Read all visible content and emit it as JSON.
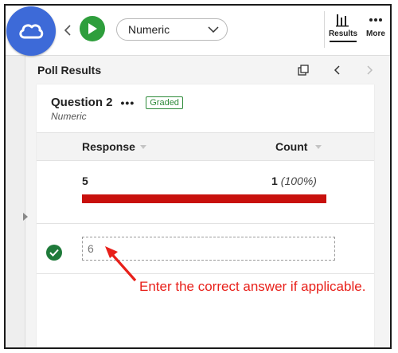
{
  "toolbar": {
    "question_type": "Numeric",
    "results_label": "Results",
    "more_label": "More"
  },
  "poll": {
    "title": "Poll Results"
  },
  "question": {
    "title": "Question 2",
    "dots": "•••",
    "badge": "Graded",
    "type": "Numeric"
  },
  "table": {
    "col_response": "Response",
    "col_count": "Count",
    "rows": [
      {
        "response": "5",
        "count": "1",
        "percent": "(100%)",
        "fraction": 1.0
      }
    ]
  },
  "answer": {
    "value": "6"
  },
  "callout": {
    "text": "Enter the correct answer if applicable."
  },
  "colors": {
    "brand": "#3d6ad8",
    "play": "#2e9e3c",
    "bar": "#c8100c",
    "callout": "#e8201a",
    "check": "#1f7a3a"
  }
}
